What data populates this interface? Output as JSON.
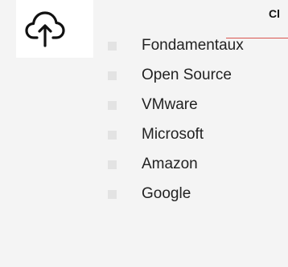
{
  "header": {
    "title": "Cl",
    "icon": "cloud-upload-icon",
    "accent_color": "#d9534f"
  },
  "menu": {
    "items": [
      {
        "label": "Fondamentaux"
      },
      {
        "label": "Open Source"
      },
      {
        "label": "VMware"
      },
      {
        "label": "Microsoft"
      },
      {
        "label": "Amazon"
      },
      {
        "label": "Google"
      }
    ]
  }
}
